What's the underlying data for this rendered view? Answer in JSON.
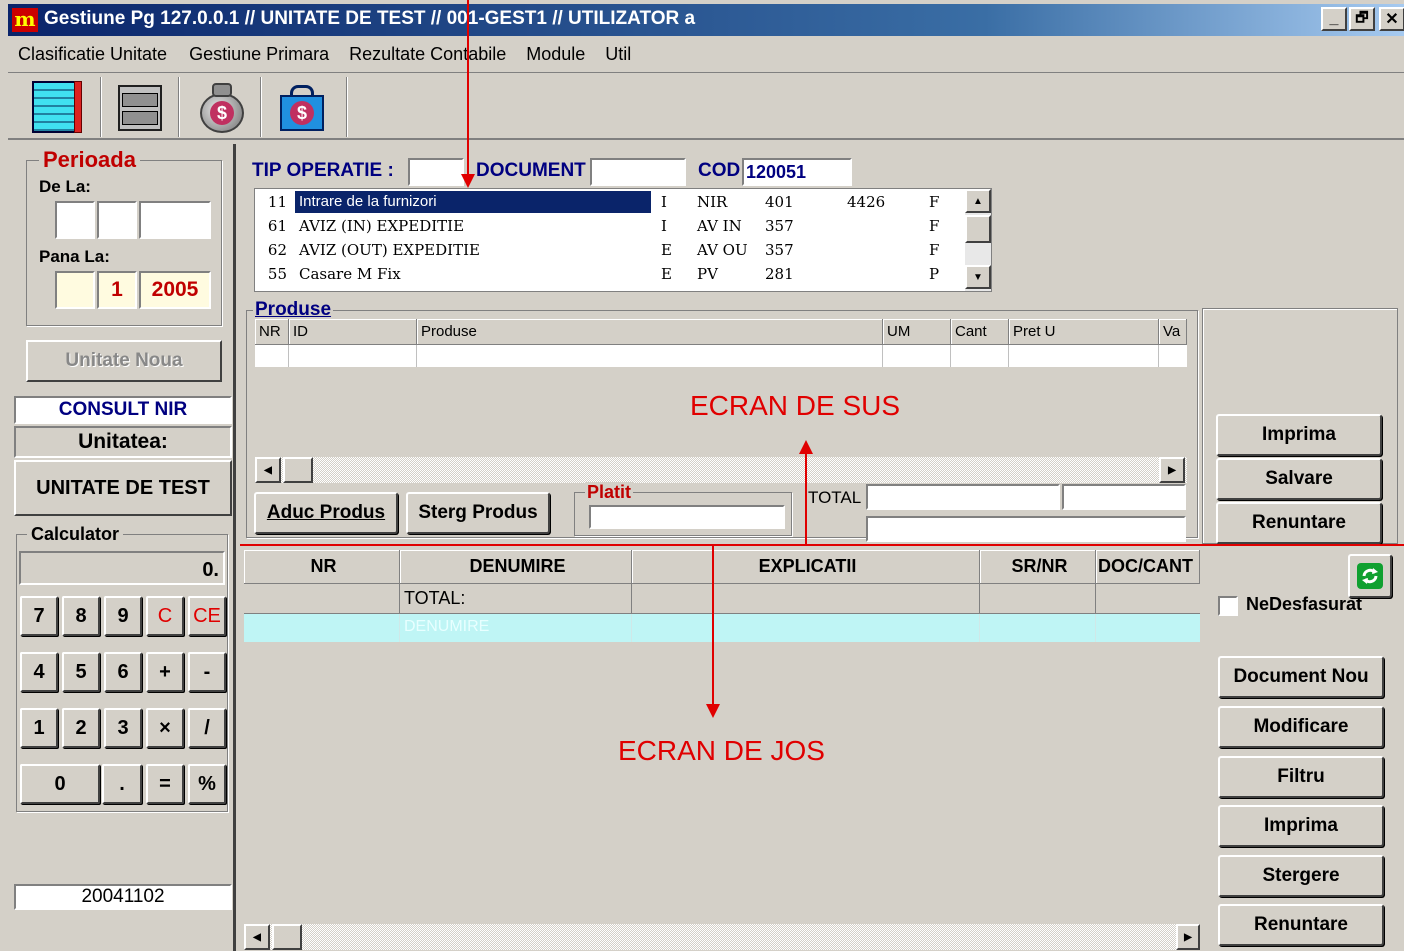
{
  "window": {
    "title": "Gestiune Pg 127.0.0.1 // UNITATE DE TEST // 001-GEST1 // UTILIZATOR a",
    "controls": [
      "_",
      "🗗",
      "✕"
    ]
  },
  "menu": [
    "Clasificatie Unitate",
    "Gestiune Primara",
    "Rezultate Contabile",
    "Module",
    "Util"
  ],
  "toolbar": {
    "icons": [
      "notebook-icon",
      "cabinet-icon",
      "money-bag-icon",
      "cash-box-icon"
    ]
  },
  "left": {
    "perioada_title": "Perioada",
    "de_la_label": "De La:",
    "de_la": [
      "",
      "",
      ""
    ],
    "pana_la_label": "Pana La:",
    "pana_la": [
      "",
      "1",
      "2005"
    ],
    "unitate_noua": "Unitate Noua",
    "consult_nir": "CONSULT NIR",
    "unitatea_label": "Unitatea:",
    "unitatea_value": "UNITATE DE TEST",
    "calculator_title": "Calculator",
    "display": "0.",
    "keys": [
      [
        "7",
        "8",
        "9",
        "C",
        "CE"
      ],
      [
        "4",
        "5",
        "6",
        "+",
        "-"
      ],
      [
        "1",
        "2",
        "3",
        "×",
        "/"
      ],
      [
        "0",
        ".",
        "=",
        "%"
      ]
    ],
    "date_value": "20041102"
  },
  "top": {
    "tip_operatie_label": "TIP OPERATIE :",
    "tip_operatie_value": "",
    "document_label": "DOCUMENT",
    "document_value": "",
    "cod_label": "COD",
    "cod_value": "120051",
    "operations": [
      {
        "nr": "11",
        "name": "Intrare de la furnizori",
        "t": "I",
        "doc": "NIR",
        "a": "401",
        "b": "4426",
        "f": "F"
      },
      {
        "nr": "61",
        "name": "AVIZ (IN) EXPEDITIE",
        "t": "I",
        "doc": "AV IN",
        "a": "357",
        "b": "",
        "f": "F"
      },
      {
        "nr": "62",
        "name": "AVIZ (OUT) EXPEDITIE",
        "t": "E",
        "doc": "AV OU",
        "a": "357",
        "b": "",
        "f": "F"
      },
      {
        "nr": "55",
        "name": "Casare M Fix",
        "t": "E",
        "doc": "PV",
        "a": "281",
        "b": "",
        "f": "P"
      }
    ],
    "produse_title": "Produse",
    "produse_columns": [
      "NR",
      "ID",
      "Produse",
      "UM",
      "Cant",
      "Pret U",
      "Va"
    ],
    "aduc_produs": "Aduc Produs",
    "sterg_produs": "Sterg Produs",
    "platit_label": "Platit",
    "platit_value": "",
    "total_label": "TOTAL",
    "buttons": [
      "Imprima",
      "Salvare",
      "Renuntare"
    ]
  },
  "bottom": {
    "columns": [
      "NR",
      "DENUMIRE",
      "EXPLICATII",
      "SR/NR",
      "DOC/CANT"
    ],
    "total_row": "TOTAL:",
    "selected_row": "DENUMIRE",
    "nedesfasurat": "NeDesfasurat",
    "buttons": [
      "Document Nou",
      "Modificare",
      "Filtru",
      "Imprima",
      "Stergere",
      "Renuntare"
    ]
  },
  "annotations": {
    "top": "ECRAN DE SUS",
    "bottom": "ECRAN DE JOS"
  },
  "colors": {
    "title_bar": "#0a246a",
    "annotation": "#e00000",
    "selection": "#0a246a",
    "row_cyan": "#bff5f5"
  }
}
